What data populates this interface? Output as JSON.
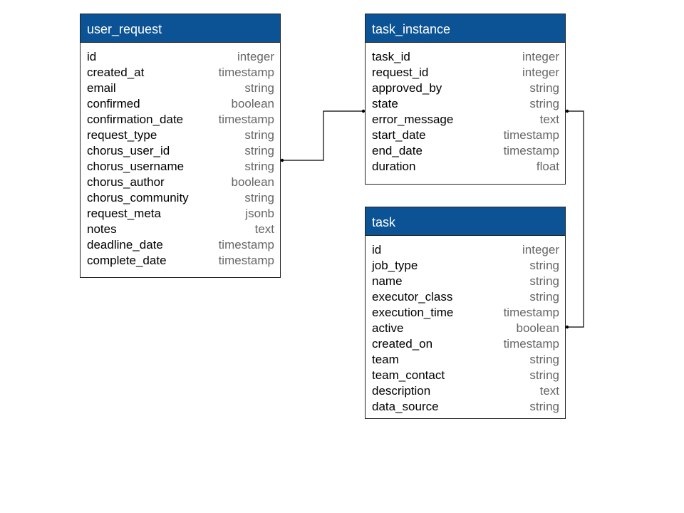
{
  "entities": {
    "user_request": {
      "title": "user_request",
      "columns": [
        {
          "name": "id",
          "type": "integer"
        },
        {
          "name": "created_at",
          "type": "timestamp"
        },
        {
          "name": "email",
          "type": "string"
        },
        {
          "name": "confirmed",
          "type": "boolean"
        },
        {
          "name": "confirmation_date",
          "type": "timestamp"
        },
        {
          "name": "request_type",
          "type": "string"
        },
        {
          "name": "chorus_user_id",
          "type": "string"
        },
        {
          "name": "chorus_username",
          "type": "string"
        },
        {
          "name": "chorus_author",
          "type": "boolean"
        },
        {
          "name": "chorus_community",
          "type": "string"
        },
        {
          "name": "request_meta",
          "type": "jsonb"
        },
        {
          "name": "notes",
          "type": "text"
        },
        {
          "name": "deadline_date",
          "type": "timestamp"
        },
        {
          "name": "complete_date",
          "type": "timestamp"
        }
      ]
    },
    "task_instance": {
      "title": "task_instance",
      "columns": [
        {
          "name": "task_id",
          "type": "integer"
        },
        {
          "name": "request_id",
          "type": "integer"
        },
        {
          "name": "approved_by",
          "type": "string"
        },
        {
          "name": "state",
          "type": "string"
        },
        {
          "name": "error_message",
          "type": "text"
        },
        {
          "name": "start_date",
          "type": "timestamp"
        },
        {
          "name": "end_date",
          "type": "timestamp"
        },
        {
          "name": "duration",
          "type": "float"
        }
      ]
    },
    "task": {
      "title": "task",
      "columns": [
        {
          "name": "id",
          "type": "integer"
        },
        {
          "name": "job_type",
          "type": "string"
        },
        {
          "name": "name",
          "type": "string"
        },
        {
          "name": "executor_class",
          "type": "string"
        },
        {
          "name": "execution_time",
          "type": "timestamp"
        },
        {
          "name": "active",
          "type": "boolean"
        },
        {
          "name": "created_on",
          "type": "timestamp"
        },
        {
          "name": "team",
          "type": "string"
        },
        {
          "name": "team_contact",
          "type": "string"
        },
        {
          "name": "description",
          "type": "text"
        },
        {
          "name": "data_source",
          "type": "string"
        }
      ]
    }
  },
  "colors": {
    "header_bg": "#0b5394",
    "header_text": "#ffffff",
    "type_text": "#666666",
    "border": "#222222"
  }
}
